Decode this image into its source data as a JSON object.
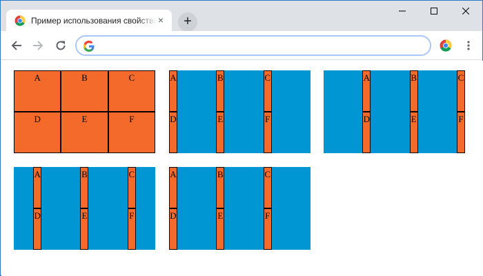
{
  "window": {
    "tab_title": "Пример использования свойства justify-self",
    "tab_close": "×",
    "new_tab": "+"
  },
  "toolbar": {
    "address_value": "",
    "address_placeholder": ""
  },
  "colors": {
    "cell": "#f46a2a",
    "container": "#0096d3",
    "border": "#000000"
  },
  "grids": [
    {
      "cells": [
        "A",
        "B",
        "C",
        "D",
        "E",
        "F"
      ]
    },
    {
      "cells": [
        "A",
        "B",
        "C",
        "D",
        "E",
        "F"
      ]
    },
    {
      "cells": [
        "A",
        "B",
        "C",
        "D",
        "E",
        "F"
      ]
    },
    {
      "cells": [
        "A",
        "B",
        "C",
        "D",
        "E",
        "F"
      ]
    },
    {
      "cells": [
        "A",
        "B",
        "C",
        "D",
        "E",
        "F"
      ]
    }
  ]
}
